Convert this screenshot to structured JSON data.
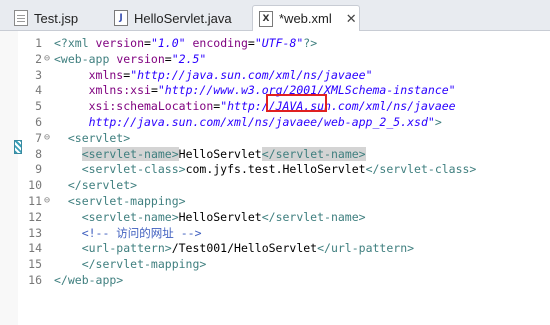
{
  "tabs": [
    {
      "label": "Test.jsp",
      "icon": "jsp-file-icon",
      "active": false
    },
    {
      "label": "HelloServlet.java",
      "icon": "java-file-icon",
      "active": false
    },
    {
      "label": "*web.xml",
      "icon": "xml-file-icon",
      "active": true,
      "close": "✕"
    }
  ],
  "icons": {
    "java": "J",
    "xml": "X"
  },
  "lines": [
    {
      "n": "1",
      "fold": "",
      "segs": [
        {
          "t": "<?xml ",
          "c": "t"
        },
        {
          "t": "version",
          "c": "a"
        },
        {
          "t": "=",
          "c": "x"
        },
        {
          "t": "\"1.0\"",
          "c": "v"
        },
        {
          "t": " encoding",
          "c": "a"
        },
        {
          "t": "=",
          "c": "x"
        },
        {
          "t": "\"UTF-8\"",
          "c": "v"
        },
        {
          "t": "?>",
          "c": "t"
        }
      ]
    },
    {
      "n": "2",
      "fold": "⊖",
      "segs": [
        {
          "t": "<web-app ",
          "c": "t"
        },
        {
          "t": "version",
          "c": "a"
        },
        {
          "t": "=",
          "c": "x"
        },
        {
          "t": "\"2.5\"",
          "c": "v"
        }
      ]
    },
    {
      "n": "3",
      "fold": "",
      "segs": [
        {
          "t": "     xmlns",
          "c": "a"
        },
        {
          "t": "=",
          "c": "x"
        },
        {
          "t": "\"http://java.sun.com/xml/ns/javaee\"",
          "c": "v"
        }
      ]
    },
    {
      "n": "4",
      "fold": "",
      "segs": [
        {
          "t": "     xmlns:xsi",
          "c": "a"
        },
        {
          "t": "=",
          "c": "x"
        },
        {
          "t": "\"http://www.w3.org/2001/XMLSchema-instance\"",
          "c": "v"
        }
      ]
    },
    {
      "n": "5",
      "fold": "",
      "segs": [
        {
          "t": "     xsi:schemaLocation",
          "c": "a"
        },
        {
          "t": "=",
          "c": "x"
        },
        {
          "t": "\"http://JAVA.sun.com/xml/ns/javaee",
          "c": "v"
        }
      ]
    },
    {
      "n": "6",
      "fold": "",
      "segs": [
        {
          "t": "     http://java.sun.com/xml/ns/javaee/web-app_2_5.xsd\"",
          "c": "v"
        },
        {
          "t": ">",
          "c": "t"
        }
      ]
    },
    {
      "n": "7",
      "fold": "⊖",
      "segs": [
        {
          "t": "  <servlet>",
          "c": "t"
        }
      ]
    },
    {
      "n": "8",
      "fold": "",
      "segs": [
        {
          "t": "    ",
          "c": "x"
        },
        {
          "t": "<servlet-name>",
          "c": "t",
          "m": 1
        },
        {
          "t": "HelloServlet",
          "c": "x"
        },
        {
          "t": "</servlet-name>",
          "c": "t",
          "m": 1
        }
      ]
    },
    {
      "n": "9",
      "fold": "",
      "segs": [
        {
          "t": "    <servlet-class>",
          "c": "t"
        },
        {
          "t": "com.jyfs.test.HelloServlet",
          "c": "x"
        },
        {
          "t": "</servlet-class>",
          "c": "t"
        }
      ]
    },
    {
      "n": "10",
      "fold": "",
      "segs": [
        {
          "t": "  </servlet>",
          "c": "t"
        }
      ]
    },
    {
      "n": "11",
      "fold": "⊖",
      "segs": [
        {
          "t": "  <servlet-mapping>",
          "c": "t"
        }
      ]
    },
    {
      "n": "12",
      "fold": "",
      "segs": [
        {
          "t": "    <servlet-name>",
          "c": "t"
        },
        {
          "t": "HelloServlet",
          "c": "x"
        },
        {
          "t": "</servlet-name>",
          "c": "t"
        }
      ]
    },
    {
      "n": "13",
      "fold": "",
      "segs": [
        {
          "t": "    <!-- 访问的网址 -->",
          "c": "c"
        }
      ]
    },
    {
      "n": "14",
      "fold": "",
      "segs": [
        {
          "t": "    <url-pattern>",
          "c": "t"
        },
        {
          "t": "/Test001/HelloServlet",
          "c": "x"
        },
        {
          "t": "</url-pattern>",
          "c": "t"
        }
      ]
    },
    {
      "n": "15",
      "fold": "",
      "segs": [
        {
          "t": "    </servlet-mapping>",
          "c": "t"
        }
      ]
    },
    {
      "n": "16",
      "fold": "",
      "segs": [
        {
          "t": "</web-app>",
          "c": "t"
        }
      ]
    }
  ]
}
